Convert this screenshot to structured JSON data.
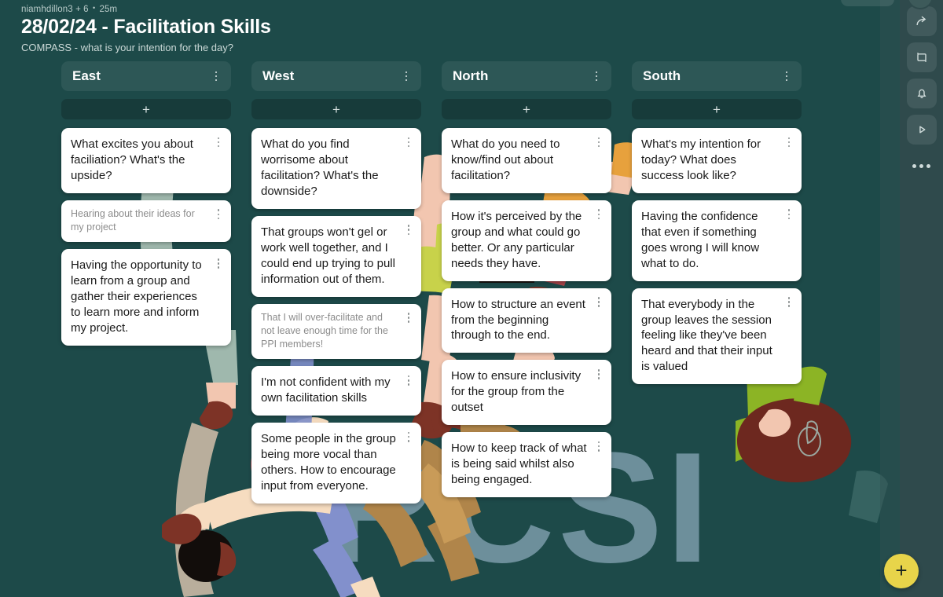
{
  "header": {
    "author": "niamhdillon3 + 6",
    "separator": "•",
    "duration": "25m",
    "title": "28/02/24 - Facilitation Skills",
    "subtitle": "COMPASS - what is your intention for the day?"
  },
  "colors": {
    "canvas": "#1d4a49",
    "rail": "#2f4a4c",
    "card": "#ffffff",
    "fab": "#e8d44a",
    "watermark": "#6d8f9b",
    "title_text": "#ffffff"
  },
  "board": {
    "add_label": "+",
    "columns": [
      {
        "title": "East",
        "cards": [
          {
            "text": "What excites you about faciliation? What's the upside?",
            "muted": false
          },
          {
            "text": "Hearing about their ideas for my project",
            "muted": true
          },
          {
            "text": "Having the opportunity to learn from a group and gather their experiences to learn more and inform my project.",
            "muted": false
          }
        ]
      },
      {
        "title": "West",
        "cards": [
          {
            "text": "What do you find worrisome about facilitation? What's the downside?",
            "muted": false
          },
          {
            "text": "That groups won't gel or work well together, and I could end up trying to pull information out of them.",
            "muted": false
          },
          {
            "text": "That I will over-facilitate and not leave enough time for the PPI members!",
            "muted": true
          },
          {
            "text": "I'm not confident with my own facilitation skills",
            "muted": false
          },
          {
            "text": "Some people in the group being more vocal than others. How to encourage input from everyone.",
            "muted": false
          }
        ]
      },
      {
        "title": "North",
        "cards": [
          {
            "text": "What do you need to know/find out about facilitation?",
            "muted": false
          },
          {
            "text": "How it's perceived by the group and what could go better. Or any particular needs they have.",
            "muted": false
          },
          {
            "text": "How to structure an event from the beginning through to the end.",
            "muted": false
          },
          {
            "text": "How to ensure inclusivity for the group from the outset",
            "muted": false
          },
          {
            "text": "How to keep track of what is being said whilst also being engaged.",
            "muted": false
          }
        ]
      },
      {
        "title": "South",
        "cards": [
          {
            "text": "What's my intention for today? What does success look like?",
            "muted": false
          },
          {
            "text": "Having the confidence that even if something goes wrong I will know what to do.",
            "muted": false
          },
          {
            "text": "That everybody in the group leaves the session feeling like they've been heard and that their input is valued",
            "muted": false
          }
        ]
      }
    ]
  },
  "right_rail": {
    "items": [
      {
        "icon": "share-arrow-icon"
      },
      {
        "icon": "frame-crop-icon"
      },
      {
        "icon": "bell-icon"
      },
      {
        "icon": "play-icon"
      }
    ],
    "more_icon": "more-horizontal-icon"
  },
  "fab": {
    "label": "+",
    "icon": "plus-icon"
  },
  "background": {
    "watermark_text": "RCSI"
  }
}
